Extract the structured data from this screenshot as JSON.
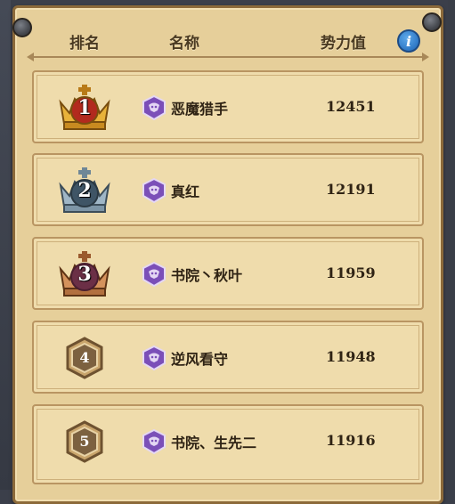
{
  "header": {
    "rank_label": "排名",
    "name_label": "名称",
    "power_label": "势力值",
    "info_label": "i"
  },
  "rows": [
    {
      "rank": "1",
      "name": "恶魔猎手",
      "power": "12451",
      "medal": "gold"
    },
    {
      "rank": "2",
      "name": "真红",
      "power": "12191",
      "medal": "silver"
    },
    {
      "rank": "3",
      "name": "书院丶秋叶",
      "power": "11959",
      "medal": "bronze"
    },
    {
      "rank": "4",
      "name": "逆风看守",
      "power": "11948",
      "medal": "hex"
    },
    {
      "rank": "5",
      "name": "书院、生先二",
      "power": "11916",
      "medal": "hex"
    }
  ],
  "colors": {
    "gold": "#e0a92a",
    "silver": "#8aa3b5",
    "bronze": "#c47d4c",
    "hex": "#8c6a3a",
    "guild": "#7b4fb8"
  }
}
